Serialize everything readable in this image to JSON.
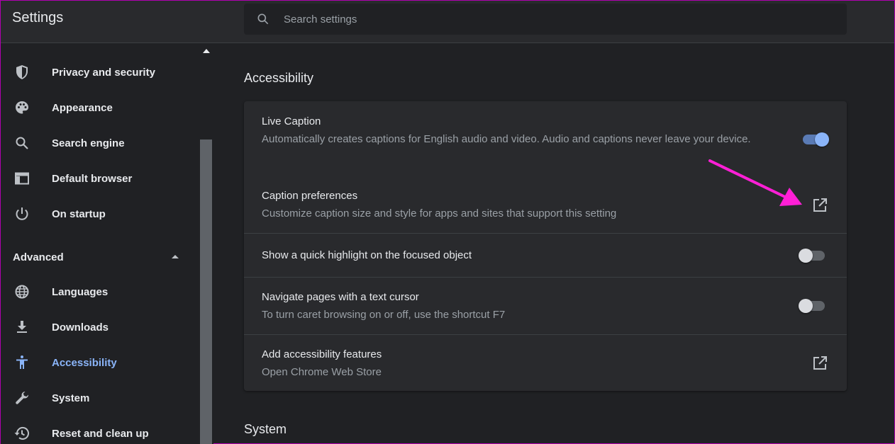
{
  "header": {
    "title": "Settings",
    "search_placeholder": "Search settings"
  },
  "sidebar": {
    "items": [
      {
        "label": "Privacy and security",
        "icon": "shield-icon"
      },
      {
        "label": "Appearance",
        "icon": "palette-icon"
      },
      {
        "label": "Search engine",
        "icon": "search-icon"
      },
      {
        "label": "Default browser",
        "icon": "browser-window-icon"
      },
      {
        "label": "On startup",
        "icon": "power-icon"
      }
    ],
    "advanced_label": "Advanced",
    "advanced_items": [
      {
        "label": "Languages",
        "icon": "globe-icon"
      },
      {
        "label": "Downloads",
        "icon": "download-icon"
      },
      {
        "label": "Accessibility",
        "icon": "accessibility-icon",
        "active": true
      },
      {
        "label": "System",
        "icon": "wrench-icon"
      },
      {
        "label": "Reset and clean up",
        "icon": "restore-icon"
      }
    ]
  },
  "main": {
    "section_title": "Accessibility",
    "rows": [
      {
        "primary": "Live Caption",
        "secondary": "Automatically creates captions for English audio and video. Audio and captions never leave your device.",
        "control": "toggle",
        "enabled": true
      },
      {
        "primary": "Caption preferences",
        "secondary": "Customize caption size and style for apps and sites that support this setting",
        "control": "launch"
      },
      {
        "primary": "Show a quick highlight on the focused object",
        "secondary": "",
        "control": "toggle",
        "enabled": false
      },
      {
        "primary": "Navigate pages with a text cursor",
        "secondary": "To turn caret browsing on or off, use the shortcut F7",
        "control": "toggle",
        "enabled": false
      },
      {
        "primary": "Add accessibility features",
        "secondary": "Open Chrome Web Store",
        "control": "launch"
      }
    ],
    "next_section_title": "System"
  },
  "colors": {
    "accent": "#8ab4f8",
    "background": "#202124",
    "card": "#292a2d",
    "annotation_arrow": "#ff1fd6"
  }
}
